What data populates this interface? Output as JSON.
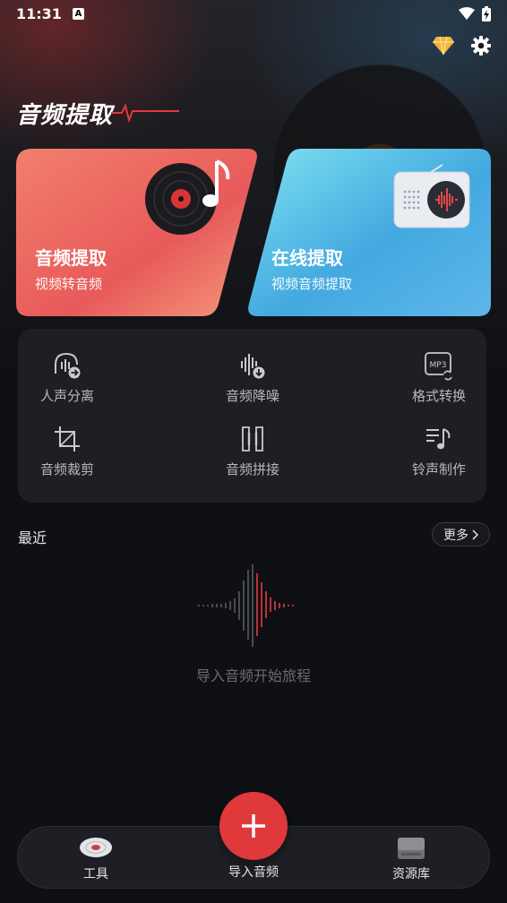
{
  "status_bar": {
    "time": "11:31",
    "notification_letter": "A"
  },
  "header": {
    "title": "音频提取"
  },
  "cards": [
    {
      "title": "音频提取",
      "subtitle": "视频转音频"
    },
    {
      "title": "在线提取",
      "subtitle": "视频音频提取"
    }
  ],
  "tools": [
    {
      "label": "人声分离",
      "icon": "voice-separate-icon"
    },
    {
      "label": "音频降噪",
      "icon": "noise-reduce-icon"
    },
    {
      "label": "格式转换",
      "icon": "format-convert-icon",
      "icon_text": "MP3"
    },
    {
      "label": "音频裁剪",
      "icon": "crop-icon"
    },
    {
      "label": "音频拼接",
      "icon": "splice-icon"
    },
    {
      "label": "铃声制作",
      "icon": "ringtone-icon"
    }
  ],
  "recent": {
    "label": "最近",
    "more_label": "更多",
    "empty_text": "导入音频开始旅程"
  },
  "bottom_nav": {
    "tools_label": "工具",
    "import_label": "导入音频",
    "library_label": "资源库"
  },
  "colors": {
    "accent_red": "#e0393b",
    "card_left": "#e85a5a",
    "card_right": "#4aaee0",
    "panel": "#1e1f24",
    "background": "#0f1014"
  }
}
